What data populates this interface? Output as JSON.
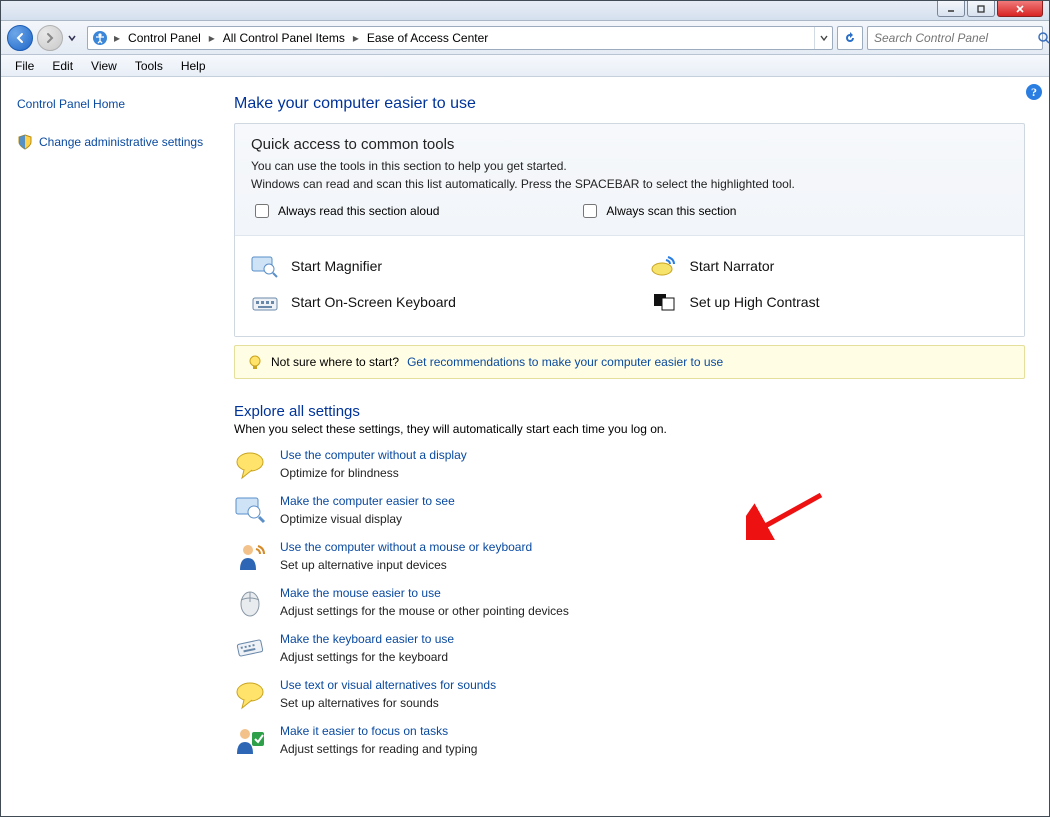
{
  "titlebar": {
    "min": "Minimize",
    "max": "Maximize",
    "close": "Close"
  },
  "breadcrumb": {
    "segments": [
      "Control Panel",
      "All Control Panel Items",
      "Ease of Access Center"
    ]
  },
  "search": {
    "placeholder": "Search Control Panel"
  },
  "menu": {
    "items": [
      "File",
      "Edit",
      "View",
      "Tools",
      "Help"
    ]
  },
  "sidebar": {
    "home": "Control Panel Home",
    "admin": "Change administrative settings"
  },
  "main": {
    "title": "Make your computer easier to use",
    "quick": {
      "heading": "Quick access to common tools",
      "line1": "You can use the tools in this section to help you get started.",
      "line2": "Windows can read and scan this list automatically.  Press the SPACEBAR to select the highlighted tool.",
      "chk_read": "Always read this section aloud",
      "chk_scan": "Always scan this section"
    },
    "tools": [
      {
        "label": "Start Magnifier"
      },
      {
        "label": "Start Narrator"
      },
      {
        "label": "Start On-Screen Keyboard"
      },
      {
        "label": "Set up High Contrast"
      }
    ],
    "hint": {
      "lead": "Not sure where to start?",
      "link": "Get recommendations to make your computer easier to use"
    },
    "explore": {
      "heading": "Explore all settings",
      "note": "When you select these settings, they will automatically start each time you log on."
    },
    "settings": [
      {
        "title": "Use the computer without a display",
        "desc": "Optimize for blindness"
      },
      {
        "title": "Make the computer easier to see",
        "desc": "Optimize visual display"
      },
      {
        "title": "Use the computer without a mouse or keyboard",
        "desc": "Set up alternative input devices"
      },
      {
        "title": "Make the mouse easier to use",
        "desc": "Adjust settings for the mouse or other pointing devices"
      },
      {
        "title": "Make the keyboard easier to use",
        "desc": "Adjust settings for the keyboard"
      },
      {
        "title": "Use text or visual alternatives for sounds",
        "desc": "Set up alternatives for sounds"
      },
      {
        "title": "Make it easier to focus on tasks",
        "desc": "Adjust settings for reading and typing"
      }
    ]
  }
}
